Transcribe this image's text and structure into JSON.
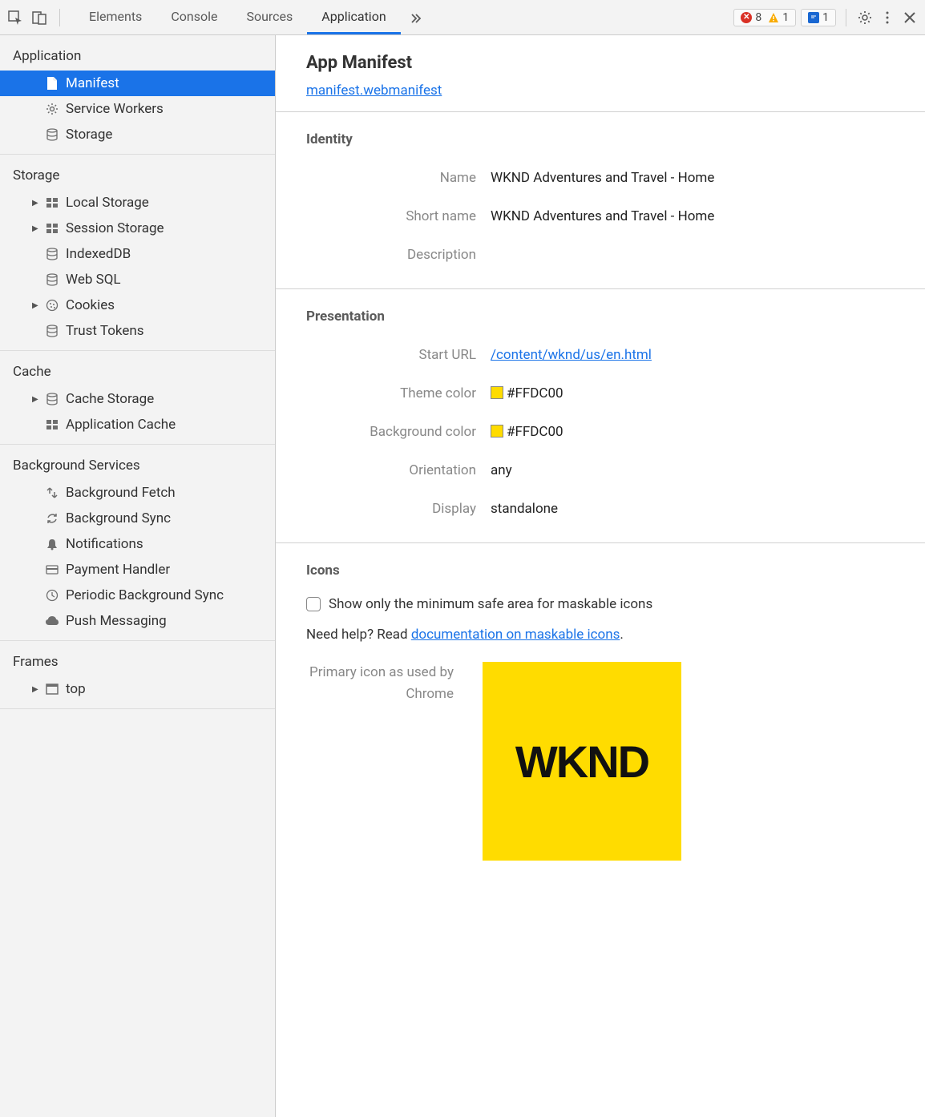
{
  "toolbar": {
    "tabs": [
      "Elements",
      "Console",
      "Sources",
      "Application"
    ],
    "active_tab": "Application",
    "errors": "8",
    "warnings": "1",
    "issues": "1"
  },
  "sidebar": {
    "application": {
      "heading": "Application",
      "items": [
        "Manifest",
        "Service Workers",
        "Storage"
      ]
    },
    "storage": {
      "heading": "Storage",
      "items": [
        "Local Storage",
        "Session Storage",
        "IndexedDB",
        "Web SQL",
        "Cookies",
        "Trust Tokens"
      ]
    },
    "cache": {
      "heading": "Cache",
      "items": [
        "Cache Storage",
        "Application Cache"
      ]
    },
    "background": {
      "heading": "Background Services",
      "items": [
        "Background Fetch",
        "Background Sync",
        "Notifications",
        "Payment Handler",
        "Periodic Background Sync",
        "Push Messaging"
      ]
    },
    "frames": {
      "heading": "Frames",
      "items": [
        "top"
      ]
    }
  },
  "main": {
    "title": "App Manifest",
    "manifest_link": "manifest.webmanifest",
    "identity": {
      "heading": "Identity",
      "name_label": "Name",
      "name_value": "WKND Adventures and Travel - Home",
      "shortname_label": "Short name",
      "shortname_value": "WKND Adventures and Travel - Home",
      "description_label": "Description",
      "description_value": ""
    },
    "presentation": {
      "heading": "Presentation",
      "starturl_label": "Start URL",
      "starturl_value": "/content/wknd/us/en.html",
      "themecolor_label": "Theme color",
      "themecolor_value": "#FFDC00",
      "bgcolor_label": "Background color",
      "bgcolor_value": "#FFDC00",
      "orientation_label": "Orientation",
      "orientation_value": "any",
      "display_label": "Display",
      "display_value": "standalone"
    },
    "icons": {
      "heading": "Icons",
      "checkbox_label": "Show only the minimum safe area for maskable icons",
      "help_prefix": "Need help? Read ",
      "help_link": "documentation on maskable icons",
      "help_suffix": ".",
      "primary_label": "Primary icon as used by Chrome",
      "preview_text": "WKND",
      "preview_bg": "#FFDC00"
    }
  }
}
